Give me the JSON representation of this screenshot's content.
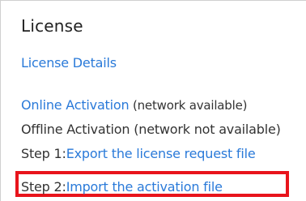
{
  "license_panel": {
    "title": "License",
    "details_link": "License Details",
    "online": {
      "link": "Online Activation",
      "note": " (network available)"
    },
    "offline": {
      "label": "Offline Activation (network not available)"
    },
    "step1": {
      "prefix": "Step 1:",
      "link": "Export the license request file"
    },
    "step2": {
      "prefix": "Step 2:",
      "link": "Import the activation file"
    }
  },
  "colors": {
    "link": "#2a7ad9",
    "highlight": "#e8141c",
    "text": "#333333"
  }
}
